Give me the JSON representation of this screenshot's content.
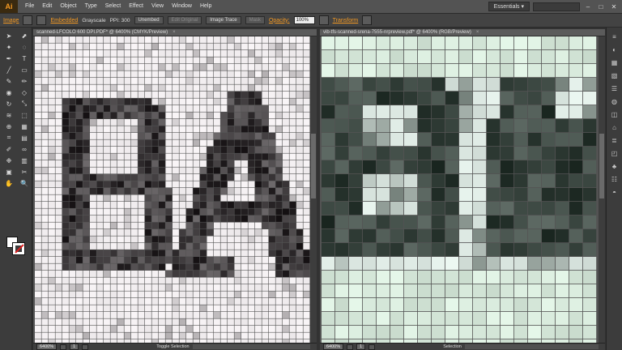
{
  "app": {
    "logo": "Ai"
  },
  "menu": [
    "File",
    "Edit",
    "Object",
    "Type",
    "Select",
    "Effect",
    "View",
    "Window",
    "Help"
  ],
  "workspace": {
    "label": "Essentials ▾"
  },
  "window_controls": {
    "minimize": "–",
    "maximize": "□",
    "close": "✕"
  },
  "control_bar": {
    "image_label": "Image",
    "embedded": "Embedded",
    "grayscale": "Grayscale",
    "ppi_label": "PPI: 300",
    "unembed": "Unembed",
    "edit_original": "Edit Original",
    "image_trace": "Image Trace",
    "mask": "Mask",
    "opacity_label": "Opacity:",
    "opacity_value": "100%",
    "transform": "Transform"
  },
  "tools": [
    "arrow",
    "direct-select",
    "magic-wand",
    "lasso",
    "pen",
    "type",
    "line",
    "rectangle",
    "paintbrush",
    "pencil",
    "blob-brush",
    "eraser",
    "rotate",
    "scale",
    "width",
    "free-transform",
    "shape-builder",
    "perspective",
    "mesh",
    "gradient",
    "eyedropper",
    "blend",
    "symbol-sprayer",
    "column-graph",
    "artboard",
    "slice",
    "hand",
    "zoom"
  ],
  "tool_glyphs": [
    "➤",
    "⬈",
    "✦",
    "◌",
    "✒",
    "T",
    "╱",
    "▭",
    "✎",
    "✏",
    "◉",
    "◇",
    "↻",
    "⤡",
    "≋",
    "⬚",
    "⊕",
    "▦",
    "⌗",
    "▤",
    "✐",
    "∞",
    "❉",
    "▥",
    "▣",
    "✂",
    "✋",
    "🔍"
  ],
  "panel_icons": [
    "≡",
    "◐",
    "▦",
    "▧",
    "☰",
    "◍",
    "◫",
    "⌂",
    "≣",
    "◰",
    "♣",
    "☷",
    "◓"
  ],
  "documents": [
    {
      "tab": "scanned-LFCOLO 600 DPI.PDF* @ 6400% (CMYK/Preview)",
      "close": "×",
      "zoom": "6400%",
      "page": "1",
      "status": "Toggle Selection"
    },
    {
      "tab": "vib-tfs-scanned-srena-7555-nrpreview.pdf* @ 6400% (RGB/Preview)",
      "close": "×",
      "zoom": "6400%",
      "page": "1",
      "status": "Selection"
    }
  ],
  "colors": {
    "accent": "#f59a23",
    "ui_dark": "#323232",
    "ui_mid": "#535353"
  }
}
